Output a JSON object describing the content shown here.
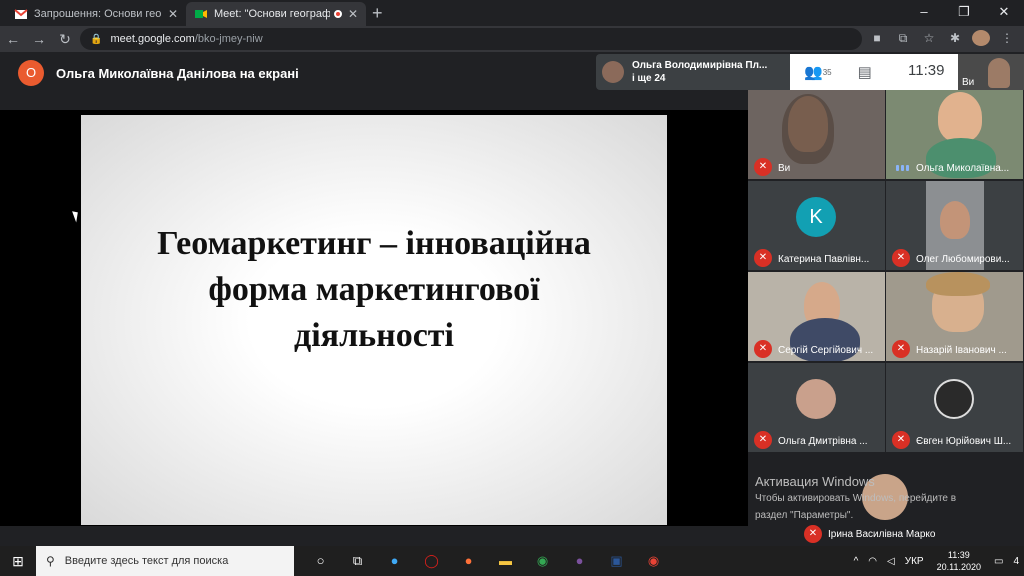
{
  "browser": {
    "tabs": [
      {
        "title": "Запрошення: Основи географіч",
        "active": false
      },
      {
        "title": "Meet: \"Основи географічно",
        "active": true
      }
    ],
    "new_tab": "+",
    "url_host": "meet.google.com",
    "url_path": "/bko-jmey-niw",
    "window_controls": {
      "minimize": "–",
      "maximize": "❐",
      "close": "✕"
    }
  },
  "meet": {
    "presenter_initial": "О",
    "presenter_text": "Ольга Миколаївна Данілова на екрані",
    "presenting_name": "Ольга Володимирівна Пл...",
    "presenting_others": "і ще 24",
    "people_count": "35",
    "time": "11:39",
    "self_label": "Ви"
  },
  "slide": {
    "line1": "Геомаркетинг – інноваційна",
    "line2": "форма маркетингової",
    "line3": "діяльності"
  },
  "participants": [
    {
      "name": "Ви",
      "muted": true
    },
    {
      "name": "Ольга Миколаївна...",
      "muted": false
    },
    {
      "name": "Катерина Павлівн...",
      "muted": true,
      "initial": "K"
    },
    {
      "name": "Олег Любомирови...",
      "muted": true
    },
    {
      "name": "Сергій Сергійович ...",
      "muted": true
    },
    {
      "name": "Назарій Іванович ...",
      "muted": true
    },
    {
      "name": "Ольга Дмитрівна ...",
      "muted": true
    },
    {
      "name": "Євген Юрійович Ш...",
      "muted": true
    },
    {
      "name": "Ірина Василівна Марко",
      "muted": true
    }
  ],
  "activation": {
    "title": "Активация Windows",
    "line1": "Чтобы активировать Windows, перейдите в",
    "line2": "раздел \"Параметры\"."
  },
  "taskbar": {
    "search_placeholder": "Введите здесь текст для поиска",
    "language": "УКР",
    "time": "11:39",
    "date": "20.11.2020",
    "notifications": "4"
  },
  "colors": {
    "meet_bg": "#202124",
    "presenter_avatar": "#ea5b2f",
    "mute_red": "#d93025",
    "letter_avatar": "#12a0b3"
  }
}
